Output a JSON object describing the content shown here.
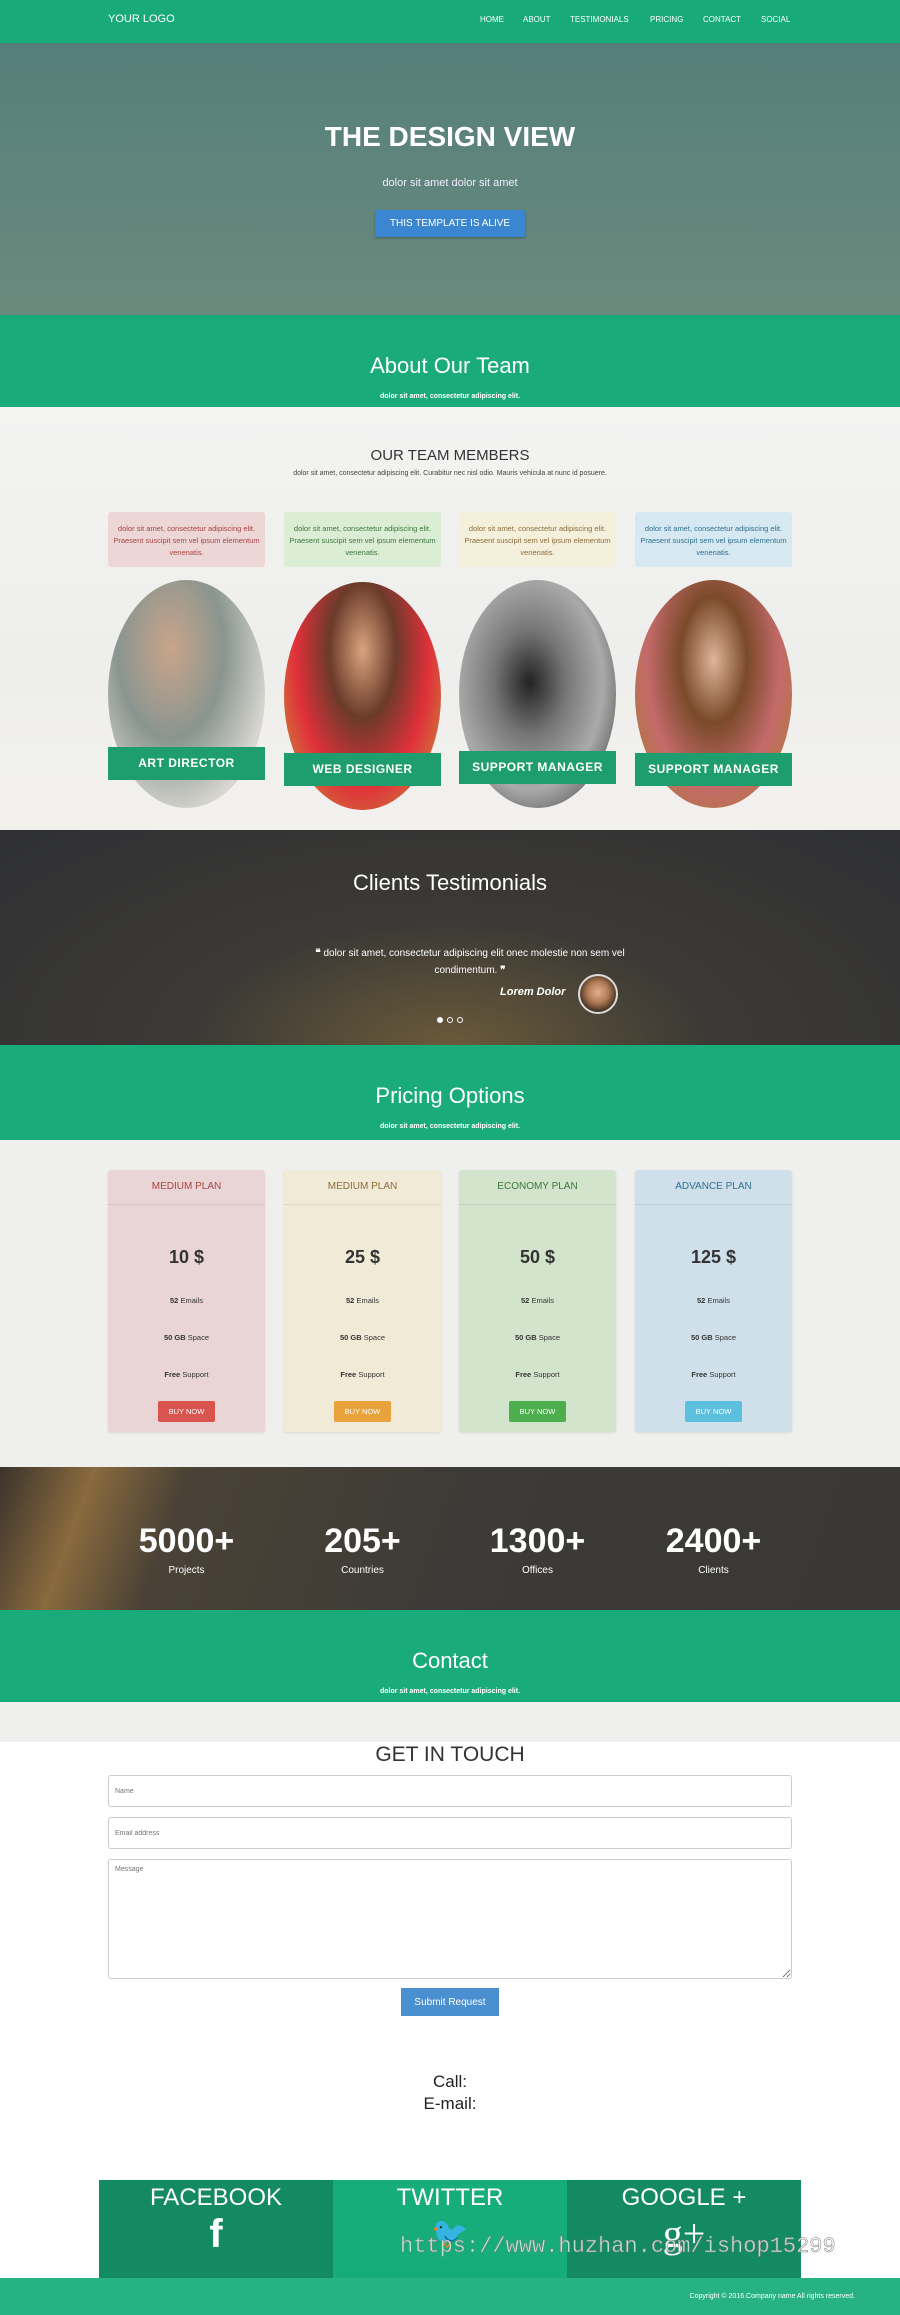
{
  "nav": {
    "logo": "YOUR LOGO",
    "items": [
      "HOME",
      "ABOUT",
      "TESTIMONIALS",
      "PRICING",
      "CONTACT",
      "SOCIAL"
    ]
  },
  "hero": {
    "title": "THE DESIGN VIEW",
    "subtitle": "dolor sit amet dolor sit amet",
    "button": "THIS TEMPLATE IS ALIVE"
  },
  "about": {
    "title": "About Our Team",
    "subtitle": "dolor sit amet, consectetur adipiscing elit."
  },
  "team": {
    "title": "OUR TEAM MEMBERS",
    "subtitle": "dolor sit amet, consectetur adipiscing elit. Curabitur nec nisl odio. Mauris vehicula at nunc id posuere.",
    "members": [
      {
        "text": "dolor sit amet, consectetur adipiscing elit. Praesent suscipit sem vel ipsum elementum venenatis.",
        "role": "ART DIRECTOR",
        "bg": "#ecd6d6",
        "color": "#a94442"
      },
      {
        "text": "dolor sit amet, consectetur adipiscing elit. Praesent suscipit sem vel ipsum elementum venenatis.",
        "role": "WEB DESIGNER",
        "bg": "#dcedd5",
        "color": "#3c763d"
      },
      {
        "text": "dolor sit amet, consectetur adipiscing elit. Praesent suscipit sem vel ipsum elementum venenatis.",
        "role": "SUPPORT MANAGER",
        "bg": "#f5f0dc",
        "color": "#8a6d3b"
      },
      {
        "text": "dolor sit amet, consectetur adipiscing elit. Praesent suscipit sem vel ipsum elementum venenatis.",
        "role": "SUPPORT MANAGER",
        "bg": "#d6e8f2",
        "color": "#31708f"
      }
    ]
  },
  "testimonials": {
    "title": "Clients Testimonials",
    "quote": "dolor sit amet, consectetur adipiscing elit onec molestie non sem vel condimentum.",
    "author": "Lorem Dolor",
    "active_slide": 1,
    "slides": 3
  },
  "pricing": {
    "title": "Pricing Options",
    "subtitle": "dolor sit amet, consectetur adipiscing elit.",
    "plans": [
      {
        "name": "MEDIUM PLAN",
        "price": "10 $",
        "emails": "52",
        "emails_label": "Emails",
        "space": "50 GB",
        "space_label": "Space",
        "support": "Free",
        "support_label": "Support",
        "button": "BUY NOW",
        "bg": "#e9d5d5",
        "head": "#a94442",
        "btn": "#d9534f"
      },
      {
        "name": "MEDIUM PLAN",
        "price": "25 $",
        "emails": "52",
        "emails_label": "Emails",
        "space": "50 GB",
        "space_label": "Space",
        "support": "Free",
        "support_label": "Support",
        "button": "BUY NOW",
        "bg": "#f1ead6",
        "head": "#8a6d3b",
        "btn": "#e8a33d"
      },
      {
        "name": "ECONOMY PLAN",
        "price": "50 $",
        "emails": "52",
        "emails_label": "Emails",
        "space": "50 GB",
        "space_label": "Space",
        "support": "Free",
        "support_label": "Support",
        "button": "BUY NOW",
        "bg": "#d3e4cc",
        "head": "#3c763d",
        "btn": "#4cae4c"
      },
      {
        "name": "ADVANCE PLAN",
        "price": "125 $",
        "emails": "52",
        "emails_label": "Emails",
        "space": "50 GB",
        "space_label": "Space",
        "support": "Free",
        "support_label": "Support",
        "button": "BUY NOW",
        "bg": "#cfe0ea",
        "head": "#31708f",
        "btn": "#5bc0de"
      }
    ]
  },
  "stats": [
    {
      "value": "5000+",
      "label": "Projects"
    },
    {
      "value": "205+",
      "label": "Countries"
    },
    {
      "value": "1300+",
      "label": "Offices"
    },
    {
      "value": "2400+",
      "label": "Clients"
    }
  ],
  "contact": {
    "title": "Contact",
    "subtitle": "dolor sit amet, consectetur adipiscing elit.",
    "form_title": "GET IN TOUCH",
    "name_placeholder": "Name",
    "email_placeholder": "Email address",
    "message_placeholder": "Message",
    "submit": "Submit Request",
    "call_label": "Call:",
    "email_label": "E-mail:"
  },
  "social": [
    {
      "name": "FACEBOOK",
      "icon": "f",
      "bg": "#138a62"
    },
    {
      "name": "TWITTER",
      "icon": "🐦",
      "bg": "#17ad7b"
    },
    {
      "name": "GOOGLE +",
      "icon": "g+",
      "bg": "#138a62"
    }
  ],
  "footer": {
    "copyright": "Copyright © 2016.Company name All rights reserved."
  },
  "watermark": "https://www.huzhan.com/ishop15299",
  "colors": {
    "brand": "#1aab7a",
    "hero_button": "#3b86d0"
  }
}
